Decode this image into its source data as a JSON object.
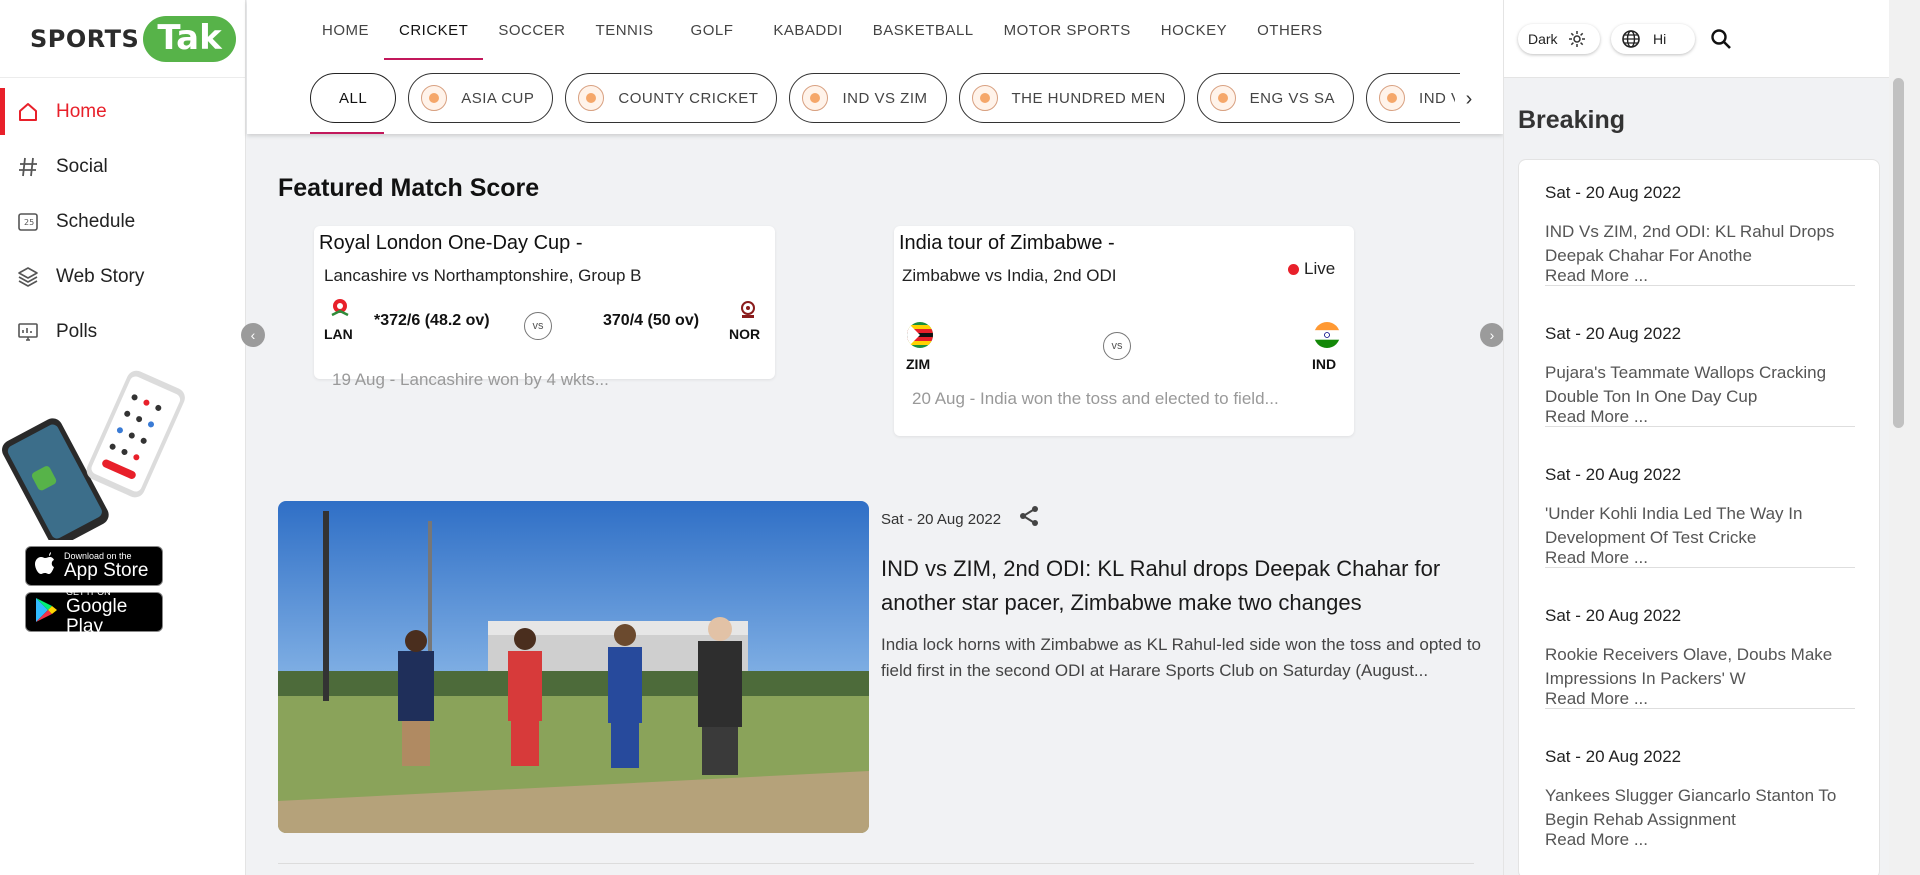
{
  "logo": {
    "text_a": "SPORTS",
    "text_b": "Tak"
  },
  "nav": [
    {
      "label": "Home",
      "icon": "home-icon"
    },
    {
      "label": "Social",
      "icon": "hashtag-icon"
    },
    {
      "label": "Schedule",
      "icon": "calendar-icon"
    },
    {
      "label": "Web Story",
      "icon": "layers-icon"
    },
    {
      "label": "Polls",
      "icon": "poll-icon"
    }
  ],
  "stores": {
    "apple_small": "Download on the",
    "apple_big": "App Store",
    "google_small": "GET IT ON",
    "google_big": "Google Play"
  },
  "sports_tabs": [
    "HOME",
    "CRICKET",
    "SOCCER",
    "TENNIS",
    "GOLF",
    "KABADDI",
    "BASKETBALL",
    "MOTOR SPORTS",
    "HOCKEY",
    "OTHERS"
  ],
  "active_sport": "CRICKET",
  "chips": [
    "ALL",
    "ASIA CUP",
    "COUNTY CRICKET",
    "IND VS ZIM",
    "THE HUNDRED MEN",
    "ENG VS SA",
    "IND VS WI"
  ],
  "featured": {
    "title": "Featured Match Score",
    "match1": {
      "tournament": "Royal London One-Day Cup -",
      "subtitle": "Lancashire vs Northamptonshire, Group B",
      "team1": "LAN",
      "score1": "*372/6 (48.2 ov)",
      "vs": "vs",
      "team2": "NOR",
      "score2": "370/4 (50 ov)",
      "result": "19 Aug - Lancashire won by 4 wkts..."
    },
    "match2": {
      "tournament": "India tour of Zimbabwe -",
      "subtitle": "Zimbabwe vs India, 2nd ODI",
      "live": "Live",
      "team1": "ZIM",
      "vs": "vs",
      "team2": "IND",
      "result": "20 Aug - India won the toss and elected to field..."
    }
  },
  "article": {
    "date": "Sat - 20 Aug 2022",
    "title": "IND vs ZIM, 2nd ODI: KL Rahul drops Deepak Chahar for another star pacer, Zimbabwe make two changes",
    "desc": "India lock horns with Zimbabwe as KL Rahul-led side won the toss and opted to field first in the second ODI at Harare Sports Club on Saturday (August..."
  },
  "header_right": {
    "theme": "Dark",
    "lang": "Hi"
  },
  "breaking": {
    "title": "Breaking",
    "read_more": "Read More ...",
    "items": [
      {
        "date": "Sat - 20 Aug 2022",
        "title": "IND Vs ZIM, 2nd ODI: KL Rahul Drops Deepak Chahar For Anothe"
      },
      {
        "date": "Sat - 20 Aug 2022",
        "title": "Pujara's Teammate Wallops Cracking Double Ton In One Day Cup"
      },
      {
        "date": "Sat - 20 Aug 2022",
        "title": "'Under Kohli India Led The Way In Development Of Test Cricke"
      },
      {
        "date": "Sat - 20 Aug 2022",
        "title": "Rookie Receivers Olave, Doubs Make Impressions In Packers' W"
      },
      {
        "date": "Sat - 20 Aug 2022",
        "title": "Yankees Slugger Giancarlo Stanton To Begin Rehab Assignment"
      }
    ]
  },
  "colors": {
    "accent": "#e8202a",
    "tab_underline": "#c2185b",
    "logo_green": "#57b349"
  }
}
